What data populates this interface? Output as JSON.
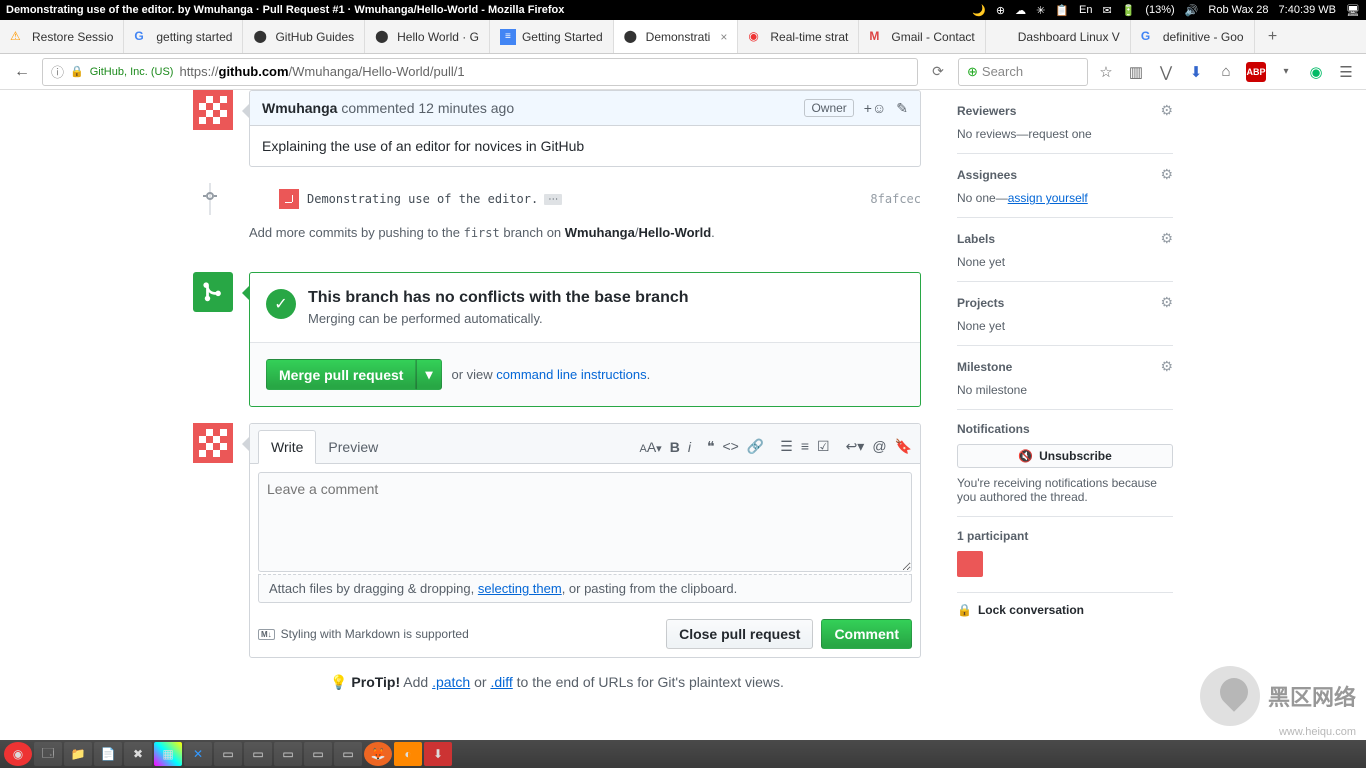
{
  "titlebar": {
    "title": "Demonstrating use of the editor. by Wmuhanga · Pull Request #1 · Wmuhanga/Hello-World - Mozilla Firefox",
    "battery": "(13%)",
    "day": "Rob Wax 28",
    "time": "7:40:39 WB"
  },
  "tabs": [
    {
      "label": "Restore Sessio",
      "fav": "⚠"
    },
    {
      "label": "getting started",
      "fav": "G"
    },
    {
      "label": "GitHub Guides",
      "fav": "gh"
    },
    {
      "label": "Hello World · G",
      "fav": "gh"
    },
    {
      "label": "Getting Started",
      "fav": "doc"
    },
    {
      "label": "Demonstrati",
      "fav": "gh",
      "active": true
    },
    {
      "label": "Real-time strat",
      "fav": "ws"
    },
    {
      "label": "Gmail - Contact",
      "fav": "M"
    },
    {
      "label": "Dashboard Linux V",
      "fav": ""
    },
    {
      "label": "definitive - Goo",
      "fav": "G"
    }
  ],
  "urlbar": {
    "cert": "GitHub, Inc. (US)",
    "prefix": "https://",
    "host": "github.com",
    "path": "/Wmuhanga/Hello-World/pull/1",
    "search_placeholder": "Search"
  },
  "comment": {
    "author": "Wmuhanga",
    "verb": "commented",
    "time": "12 minutes ago",
    "owner_badge": "Owner",
    "body": "Explaining the use of an editor for novices in GitHub"
  },
  "commit": {
    "message": "Demonstrating use of the editor.",
    "hash": "8fafcec"
  },
  "push_hint": {
    "prefix": "Add more commits by pushing to the ",
    "branch": "first",
    "mid": " branch on ",
    "owner": "Wmuhanga",
    "repo": "Hello-World"
  },
  "merge": {
    "title": "This branch has no conflicts with the base branch",
    "subtitle": "Merging can be performed automatically.",
    "button": "Merge pull request",
    "or": "or view ",
    "cli": "command line instructions"
  },
  "form": {
    "write": "Write",
    "preview": "Preview",
    "placeholder": "Leave a comment",
    "drag1": "Attach files by dragging & dropping, ",
    "drag_link": "selecting them",
    "drag2": ", or pasting from the clipboard.",
    "md_hint": "Styling with Markdown is supported",
    "md_badge": "M↓",
    "close_btn": "Close pull request",
    "comment_btn": "Comment"
  },
  "protip": {
    "label": "ProTip!",
    "t1": " Add ",
    "patch": ".patch",
    "or": " or ",
    "diff": ".diff",
    "t2": " to the end of URLs for Git's plaintext views."
  },
  "sidebar": {
    "reviewers": {
      "title": "Reviewers",
      "body": "No reviews—request one"
    },
    "assignees": {
      "title": "Assignees",
      "body1": "No one—",
      "link": "assign yourself"
    },
    "labels": {
      "title": "Labels",
      "body": "None yet"
    },
    "projects": {
      "title": "Projects",
      "body": "None yet"
    },
    "milestone": {
      "title": "Milestone",
      "body": "No milestone"
    },
    "notifications": {
      "title": "Notifications",
      "btn": "Unsubscribe",
      "desc": "You're receiving notifications because you authored the thread."
    },
    "participants": {
      "title": "1 participant"
    },
    "lock": "Lock conversation"
  },
  "watermark": {
    "text": "黑区网络",
    "sub": "www.heiqu.com"
  }
}
